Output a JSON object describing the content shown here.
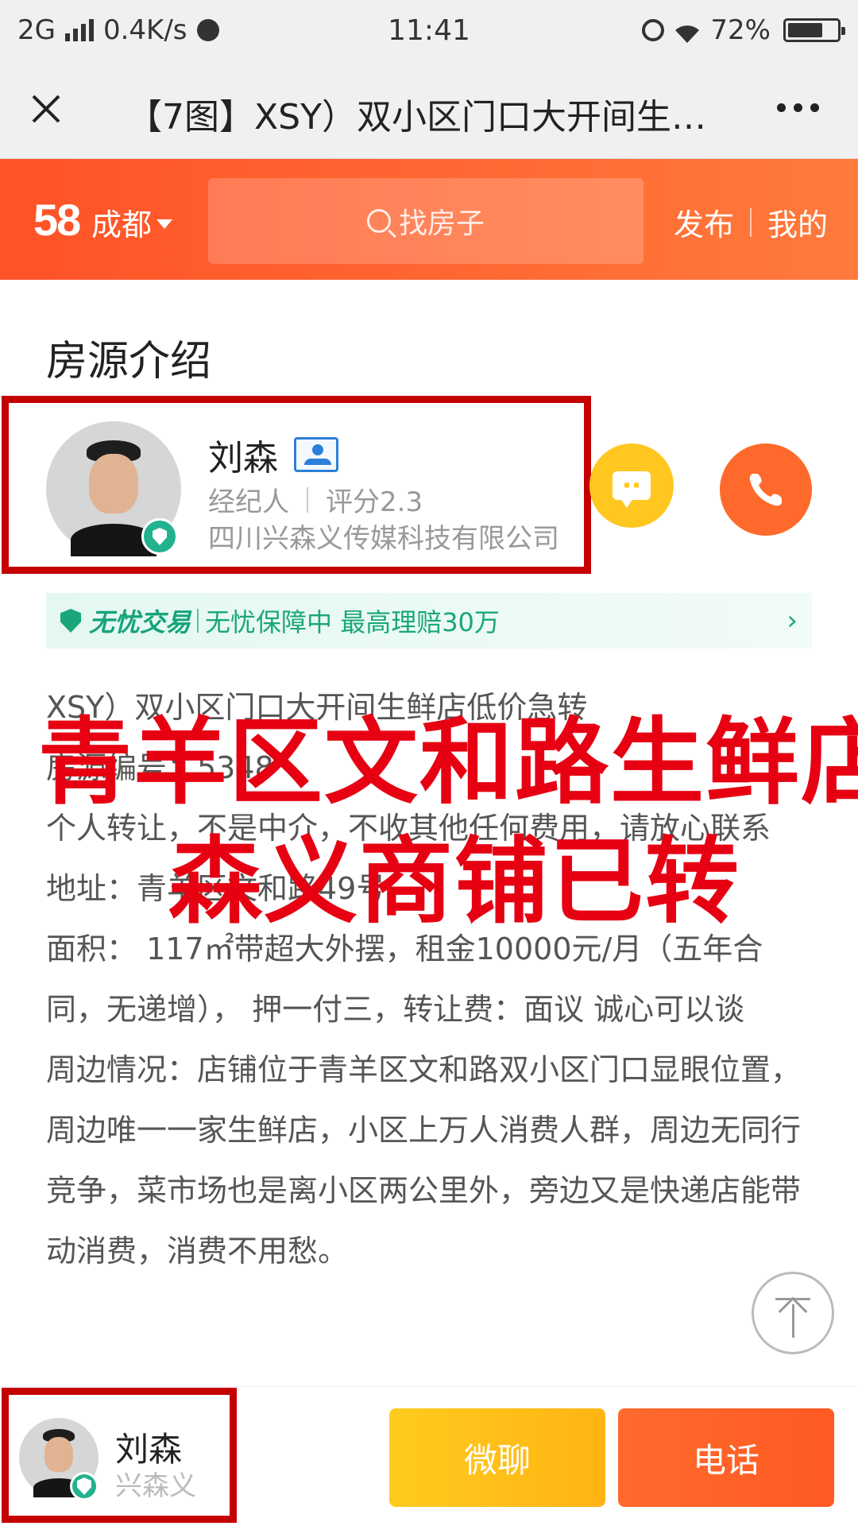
{
  "status_bar": {
    "network": "2G",
    "speed": "0.4K/s",
    "time": "11:41",
    "battery": "72%",
    "battery_level": 0.72
  },
  "title_bar": {
    "title": "【7图】XSY）双小区门口大开间生…"
  },
  "header": {
    "logo": "58",
    "city": "成都",
    "search_placeholder": "找房子",
    "publish": "发布",
    "mine": "我的"
  },
  "section": {
    "title": "房源介绍"
  },
  "agent": {
    "name": "刘森",
    "role": "经纪人",
    "rating": "评分2.3",
    "company": "四川兴森义传媒科技有限公司"
  },
  "guarantee": {
    "brand": "无忧交易",
    "text": "无忧保障中 最高理赔30万",
    "arrow": "›"
  },
  "description": {
    "lines": [
      "XSY）双小区门口大开间生鲜店低价急转",
      "房源编号：5348",
      "个人转让，不是中介，不收其他任何费用，请放心联系",
      "地址：青羊区文和路49号",
      "面积： 117㎡带超大外摆，租金10000元/月（五年合同，无递增）， 押一付三，转让费：面议 诚心可以谈",
      "周边情况：店铺位于青羊区文和路双小区门口显眼位置，周边唯一一家生鲜店，小区上万人消费人群，周边无同行竞争，菜市场也是离小区两公里外，旁边又是快递店能带动消费，消费不用愁。"
    ]
  },
  "overlay": {
    "line1": "青羊区文和路生鲜店",
    "line2": "森义商铺已转"
  },
  "bottom_bar": {
    "name": "刘森",
    "company": "兴森义",
    "wechat": "微聊",
    "call": "电话"
  },
  "colors": {
    "brand_orange": "#ff5a22",
    "chat_yellow": "#ffc71f",
    "guarantee_green": "#1aa67a",
    "overlay_red": "#e60012",
    "highlight_box": "#c40000"
  }
}
